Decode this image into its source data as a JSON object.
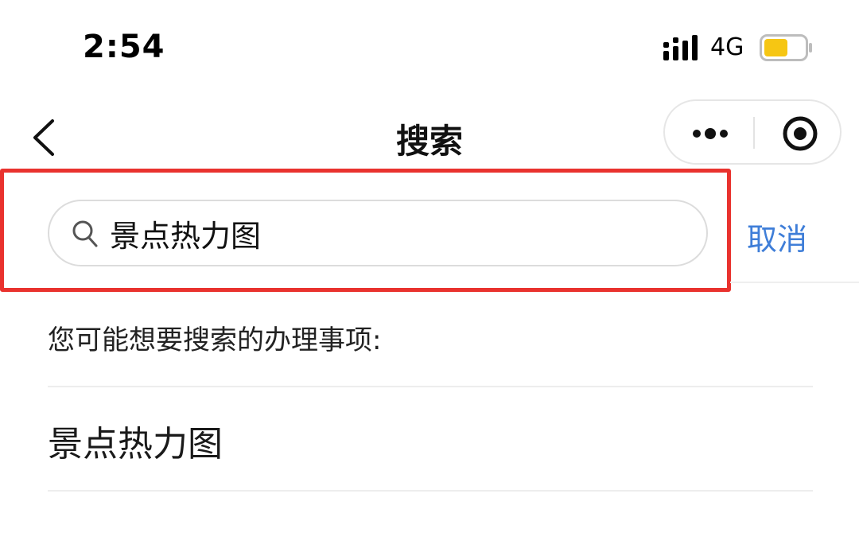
{
  "status_bar": {
    "time": "2:54",
    "network": "4G",
    "battery_color": "#f6c613"
  },
  "nav": {
    "title": "搜索",
    "back_icon": "chevron-left-icon",
    "more_icon": "more-dots-icon",
    "close_icon": "record-target-icon"
  },
  "search": {
    "value": "景点热力图",
    "icon": "search-icon",
    "cancel_label": "取消",
    "cancel_color": "#3f7ed8",
    "highlight_color": "#e9322e"
  },
  "suggestions": {
    "hint": "您可能想要搜索的办理事项:",
    "items": [
      {
        "label": "景点热力图"
      }
    ]
  }
}
